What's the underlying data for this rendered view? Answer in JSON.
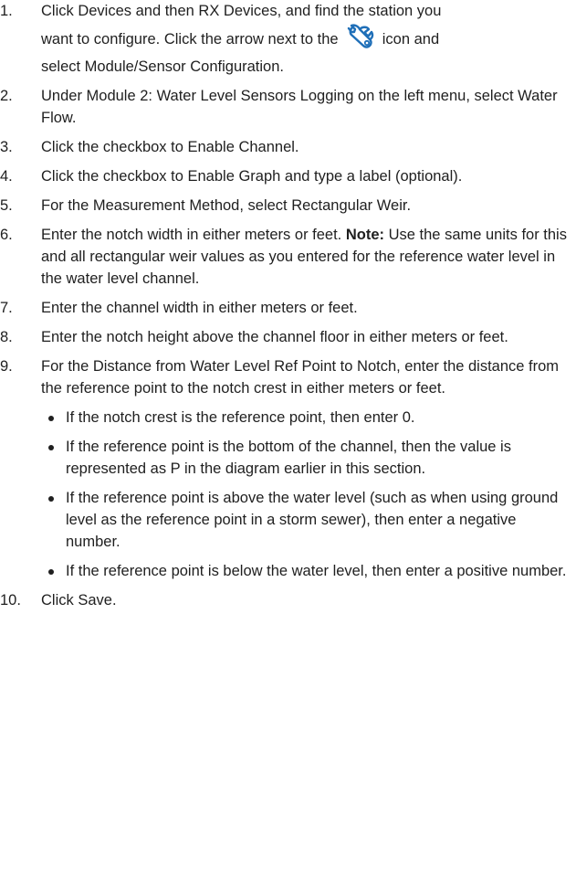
{
  "steps": [
    {
      "num": "1.",
      "line1": "Click Devices and then RX Devices, and find the station you",
      "line2a": "want to configure. Click the arrow next to the",
      "icon": "wrench-icon",
      "line2b": "icon and",
      "line3": "select Module/Sensor Configuration."
    },
    {
      "num": "2.",
      "text": "Under Module 2: Water Level Sensors Logging on the left menu, select Water Flow."
    },
    {
      "num": "3.",
      "text": "Click the checkbox to Enable Channel."
    },
    {
      "num": "4.",
      "text": "Click the checkbox to Enable Graph and type a label (optional)."
    },
    {
      "num": "5.",
      "text": "For the Measurement Method, select Rectangular Weir."
    },
    {
      "num": "6.",
      "text": "Enter the notch width in either meters or feet.",
      "note_label": "Note:",
      "note_text": "Use the same units for this and all rectangular weir values as you entered for the reference water level in the water level channel."
    },
    {
      "num": "7.",
      "text": "Enter the channel width in either meters or feet."
    },
    {
      "num": "8.",
      "text": "Enter the notch height above the channel floor in either meters or feet."
    },
    {
      "num": "9.",
      "text": "For the Distance from Water Level Ref Point to Notch, enter the distance from the reference point to the notch crest in either meters or feet.",
      "bullets": [
        "If the notch crest is the reference point, then enter 0.",
        "If the reference point is the bottom of the channel, then the value is represented as P in the diagram earlier in this section.",
        "If the reference point is above the water level (such as when using ground level as the reference point in a storm sewer), then enter a negative number.",
        "If the reference point is below the water level, then enter a positive number."
      ]
    },
    {
      "num": "10.",
      "text": "Click Save."
    }
  ],
  "colors": {
    "text": "#1f1f1f",
    "icon": "#1f6fb8"
  }
}
